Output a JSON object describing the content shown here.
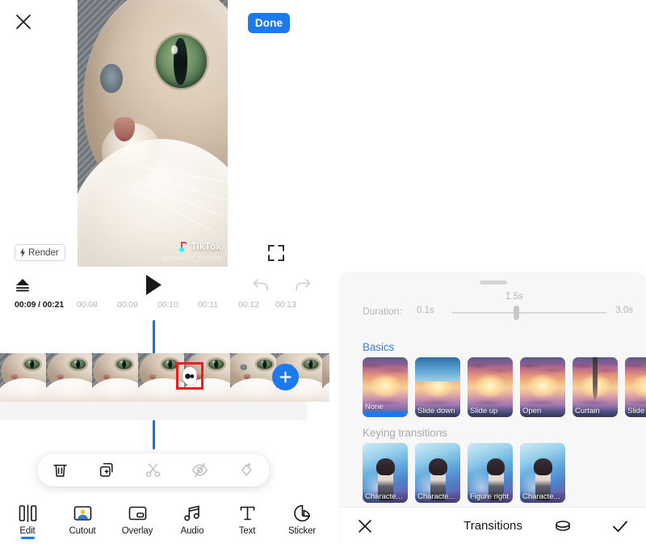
{
  "editor": {
    "close_icon": "close-icon",
    "done_label": "Done",
    "render_label": "Render",
    "watermark": "TikTok",
    "watermark_sub": "@creator_profile",
    "transport": {
      "eject_icon": "eject-icon",
      "play_icon": "play-icon",
      "undo_icon": "undo-icon",
      "redo_icon": "redo-icon"
    },
    "timeline": {
      "current_time": "00:09 / 00:21",
      "ticks": [
        "00:08",
        "00:09",
        "00:10",
        "00:11",
        "00:12",
        "00:13"
      ],
      "transition_marker": "transition-marker",
      "add_clip_label": "+"
    },
    "clip_tools": [
      {
        "name": "delete-button",
        "icon": "trash-icon",
        "enabled": true
      },
      {
        "name": "duplicate-button",
        "icon": "copy-add-icon",
        "enabled": true
      },
      {
        "name": "split-button",
        "icon": "scissors-icon",
        "enabled": false
      },
      {
        "name": "hide-button",
        "icon": "eye-slash-icon",
        "enabled": false
      },
      {
        "name": "transition-button",
        "icon": "diamond-icon",
        "enabled": false
      }
    ],
    "nav": [
      {
        "label": "Edit",
        "icon": "edit-clips-icon",
        "active": true
      },
      {
        "label": "Cutout",
        "icon": "cutout-person-icon",
        "active": false
      },
      {
        "label": "Overlay",
        "icon": "overlay-frame-icon",
        "active": false
      },
      {
        "label": "Audio",
        "icon": "music-note-icon",
        "active": false
      },
      {
        "label": "Text",
        "icon": "text-t-icon",
        "active": false
      },
      {
        "label": "Sticker",
        "icon": "sticker-icon",
        "active": false
      }
    ]
  },
  "sheet": {
    "grabber": "drag-handle",
    "duration": {
      "label": "Duration:",
      "min": "0.1s",
      "max": "3.0s",
      "value": "1.5s"
    },
    "sections": [
      {
        "title": "Basics",
        "items": [
          {
            "label": "None",
            "selected": true,
            "art": "sunset"
          },
          {
            "label": "Slide down",
            "selected": false,
            "art": "sunset-split"
          },
          {
            "label": "Slide up",
            "selected": false,
            "art": "sunset"
          },
          {
            "label": "Open",
            "selected": false,
            "art": "sunset"
          },
          {
            "label": "Curtain",
            "selected": false,
            "art": "sunset-curtain"
          },
          {
            "label": "Slide le...",
            "selected": false,
            "art": "sunset"
          }
        ]
      },
      {
        "title": "Keying transitions",
        "items": [
          {
            "label": "Characte...",
            "selected": false,
            "art": "anime"
          },
          {
            "label": "Characte...",
            "selected": false,
            "art": "anime"
          },
          {
            "label": "Figure right",
            "selected": false,
            "art": "anime-right"
          },
          {
            "label": "Characte...",
            "selected": false,
            "art": "anime"
          }
        ]
      }
    ],
    "footer": {
      "close_icon": "close-icon",
      "title": "Transitions",
      "apply_all_icon": "coin-stack-icon",
      "confirm_icon": "check-icon"
    }
  },
  "colors": {
    "accent_blue": "#1c7aed",
    "section_blue": "#3b7fd4",
    "marker_red": "#f01c1c",
    "playhead_blue": "#1472e6"
  }
}
